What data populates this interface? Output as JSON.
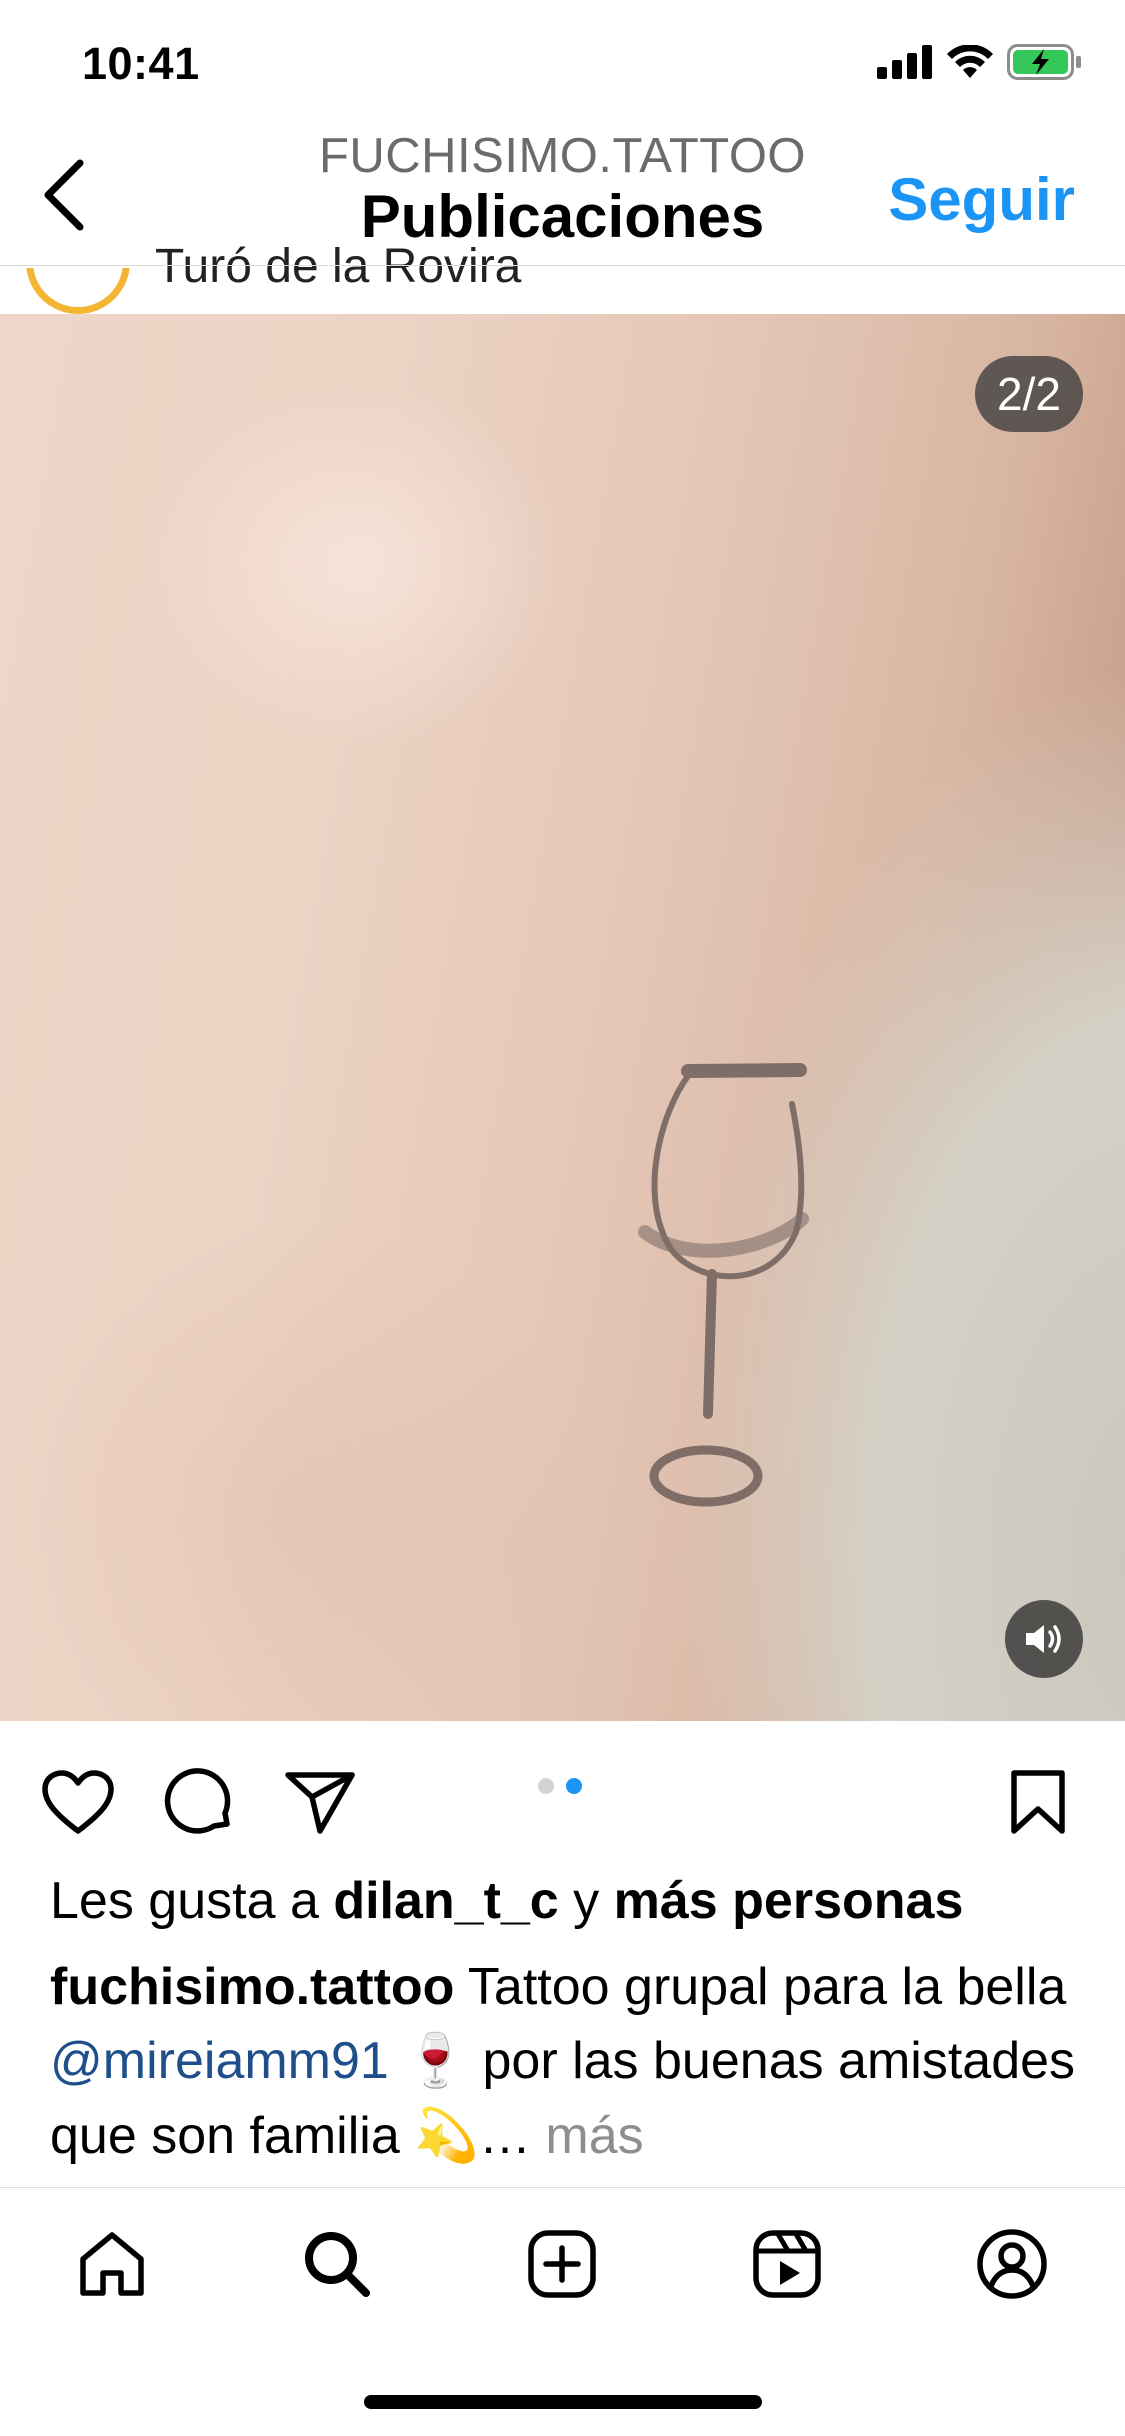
{
  "status_bar": {
    "time": "10:41"
  },
  "header": {
    "subtitle": "FUCHISIMO.TATTOO",
    "title": "Publicaciones",
    "follow_label": "Seguir"
  },
  "post_peek": {
    "location": "Turó de la Rovira"
  },
  "media": {
    "counter": "2/2"
  },
  "carousel": {
    "count": 2,
    "active_index": 2
  },
  "likes": {
    "prefix": "Les gusta a ",
    "user": "dilan_t_c",
    "connector": " y ",
    "others": "más personas"
  },
  "caption": {
    "username": "fuchisimo.tattoo",
    "text_1": " Tattoo grupal para la bella ",
    "mention": "@mireiamm91",
    "emoji_1": " 🍷 ",
    "text_2": "por las buenas amistades que son familia ",
    "emoji_2": "💫",
    "ellipsis": "… ",
    "more": "más"
  },
  "colors": {
    "accent": "#1b95f5",
    "mention": "#1f4f8a",
    "muted": "#8e8e8e",
    "battery": "#34c759"
  },
  "icons": {
    "status": [
      "signal-icon",
      "wifi-icon",
      "battery-charging-icon"
    ],
    "actions": [
      "heart-icon",
      "comment-icon",
      "share-icon",
      "bookmark-icon"
    ],
    "tabs": [
      "home-icon",
      "search-icon",
      "create-icon",
      "reels-icon",
      "profile-icon"
    ]
  }
}
